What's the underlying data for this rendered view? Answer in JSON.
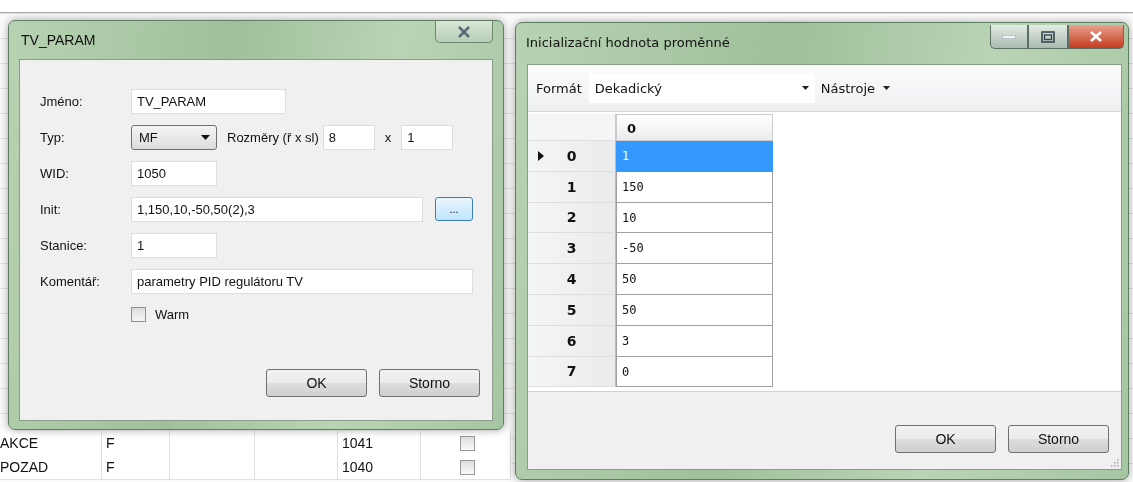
{
  "background_table": {
    "rows": [
      {
        "column_1": "AKCE",
        "column_2": "F",
        "column_5": "1041",
        "checked": false
      },
      {
        "column_1": "POZAD",
        "column_2": "F",
        "column_5": "1040",
        "checked": false
      }
    ]
  },
  "param_dialog": {
    "title": "TV_PARAM",
    "name": {
      "label": "Jméno:",
      "value": "TV_PARAM"
    },
    "type": {
      "label": "Typ:",
      "value": "MF"
    },
    "dimensions": {
      "label": "Rozměry (ř x sl)",
      "rows": "8",
      "separator": "x",
      "cols": "1"
    },
    "wid": {
      "label": "WID:",
      "value": "1050"
    },
    "init": {
      "label": "Init:",
      "value": "1,150,10,-50,50(2),3",
      "browse_button": "..."
    },
    "station": {
      "label": "Stanice:",
      "value": "1"
    },
    "comment": {
      "label": "Komentář:",
      "value": "parametry PID regulátoru TV"
    },
    "warm": {
      "label": "Warm",
      "checked": false
    },
    "buttons": [
      "OK",
      "Storno"
    ]
  },
  "init_dialog": {
    "title": "Inicializační hodnota proměnné",
    "format": {
      "label": "Formát",
      "value": "Dekadický"
    },
    "tools_menu": "Nástroje",
    "grid": {
      "column_header": "0",
      "rows": [
        {
          "index": "0",
          "value": "1",
          "selected": true
        },
        {
          "index": "1",
          "value": "150",
          "selected": false
        },
        {
          "index": "2",
          "value": "10",
          "selected": false
        },
        {
          "index": "3",
          "value": "-50",
          "selected": false
        },
        {
          "index": "4",
          "value": "50",
          "selected": false
        },
        {
          "index": "5",
          "value": "50",
          "selected": false
        },
        {
          "index": "6",
          "value": "3",
          "selected": false
        },
        {
          "index": "7",
          "value": "0",
          "selected": false
        }
      ]
    },
    "buttons": [
      "OK",
      "Storno"
    ]
  }
}
